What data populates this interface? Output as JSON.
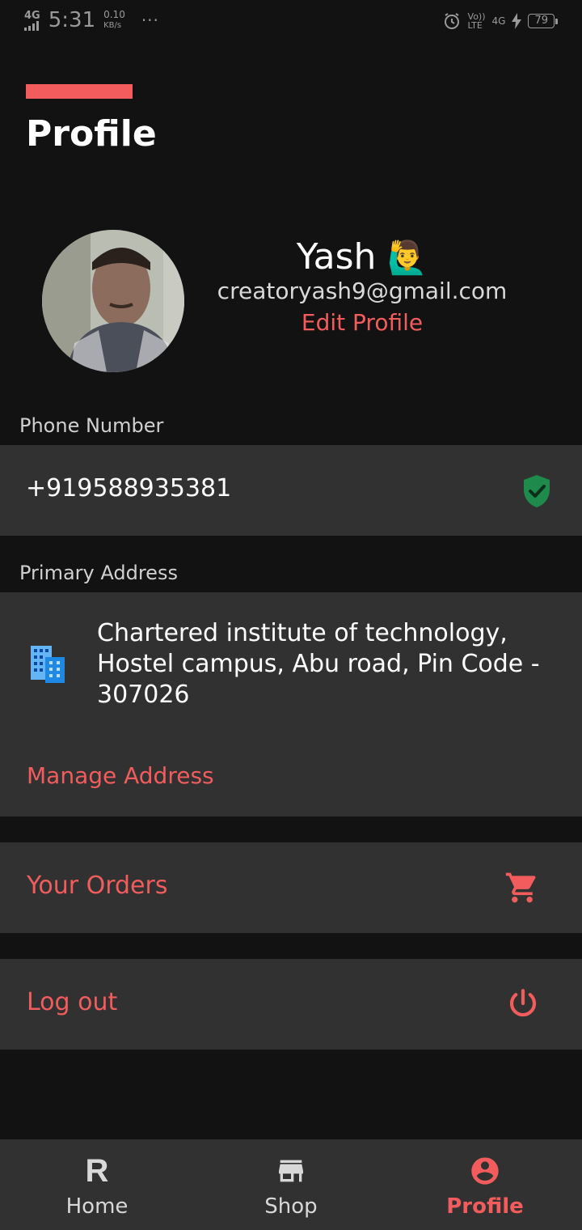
{
  "status_bar": {
    "network": "4G",
    "time": "5:31",
    "speed_value": "0.10",
    "speed_unit": "KB/s",
    "more": "···",
    "volte_top": "Vo))",
    "volte_bottom": "LTE",
    "network_right": "4G",
    "battery": "79"
  },
  "header": {
    "title": "Profile"
  },
  "profile": {
    "name": "Yash",
    "name_emoji": "🙋‍♂️",
    "email": "creatoryash9@gmail.com",
    "edit_label": "Edit Profile"
  },
  "phone": {
    "label": "Phone Number",
    "value": "+919588935381"
  },
  "address": {
    "label": "Primary Address",
    "text": "Chartered institute of technology, Hostel campus, Abu road, Pin Code - 307026",
    "manage_label": "Manage Address"
  },
  "menu": {
    "orders_label": "Your Orders",
    "logout_label": "Log out"
  },
  "nav": {
    "home_glyph": "R",
    "home_label": "Home",
    "shop_label": "Shop",
    "profile_label": "Profile"
  },
  "colors": {
    "accent": "#f25c5c",
    "card": "#313131",
    "background": "#121212",
    "verified": "#1e8a4c"
  }
}
